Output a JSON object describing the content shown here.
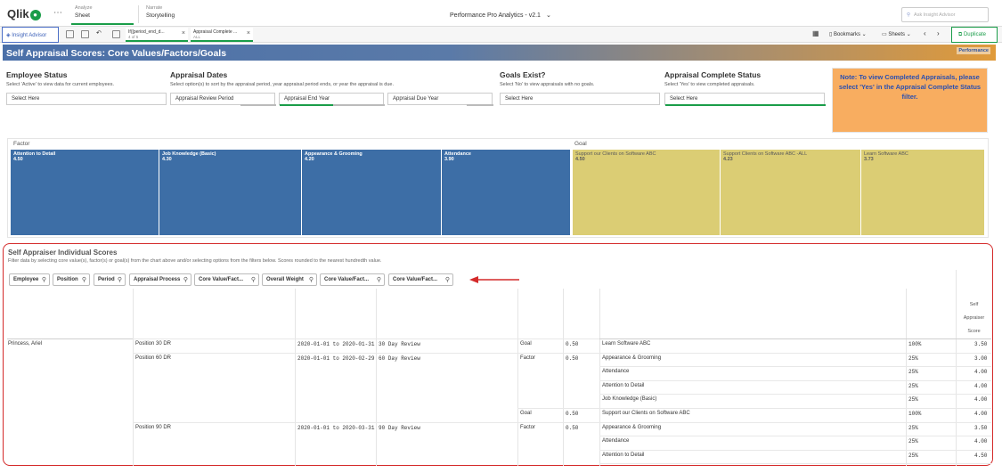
{
  "nav": {
    "logo": "Qlik",
    "analyze_small": "Analyze",
    "analyze_big": "Sheet",
    "narrate_small": "Narrate",
    "narrate_big": "Storytelling",
    "app_title": "Performance Pro Analytics - v2.1",
    "ask_placeholder": "Ask Insight Advisor"
  },
  "toolbar": {
    "insight_advisor": "Insight Advisor",
    "selections": [
      {
        "title": "If([period_end_d...",
        "sub": "4 of 5"
      },
      {
        "title": "Appraisal Complete ...",
        "sub": "ALL"
      }
    ],
    "bookmarks": "Bookmarks",
    "sheets": "Sheets",
    "duplicate": "Duplicate"
  },
  "sheet": {
    "title": "Self Appraisal Scores: Core Values/Factors/Goals",
    "logo_text": "Performance"
  },
  "filters": [
    {
      "heading": "Employee Status",
      "desc": "Select 'Active' to view data for current employees.",
      "value": "Select Here"
    },
    {
      "heading": "Appraisal Dates",
      "desc": "Select option(s) to sort by the appraisal period, year appraisal period ends, or year the appraisal is due.",
      "value": "Appraisal Review Period"
    },
    {
      "heading": "",
      "desc": "",
      "value": "Appraisal End Year"
    },
    {
      "heading": "",
      "desc": "",
      "value": "Appraisal Due Year"
    },
    {
      "heading": "Goals Exist?",
      "desc": "Select 'No' to view appraisals with no goals.",
      "value": "Select Here"
    },
    {
      "heading": "Appraisal Complete Status",
      "desc": "Select 'Yes' to view completed appraisals.",
      "value": "Select Here"
    }
  ],
  "note": "Note: To view Completed Appraisals, please select 'Yes' in the Appraisal Complete Status filter.",
  "treemap": {
    "factor_label": "Factor",
    "goal_label": "Goal",
    "factors": [
      {
        "name": "Attention to Detail",
        "value": "4.50"
      },
      {
        "name": "Job Knowledge (Basic)",
        "value": "4.30"
      },
      {
        "name": "Appearance & Grooming",
        "value": "4.20"
      },
      {
        "name": "Attendance",
        "value": "3.90"
      }
    ],
    "goals": [
      {
        "name": "Support our Clients on Software ABC",
        "value": "4.50"
      },
      {
        "name": "Support Clients on Software ABC -ALL",
        "value": "4.23"
      },
      {
        "name": "Learn Software ABC",
        "value": "3.73"
      }
    ]
  },
  "table": {
    "title": "Self Appraiser Individual Scores",
    "desc": "Filter data by selecting core value(s), factor(s) or goal(s) from the chart above and/or selecting options from the filters below. Scores rounded to the nearest hundredth value.",
    "column_searches": [
      "Employee",
      "Position",
      "Period",
      "Appraisal Process",
      "Core Value/Fact...",
      "Overall Weight",
      "Core Value/Fact...",
      "Core Value/Fact..."
    ],
    "score_header": [
      "Self",
      "Appraiser",
      "Score"
    ],
    "rows": [
      {
        "employee": "Princess, Ariel",
        "position": "Position 30 DR",
        "period": "2020-01-01 to 2020-01-31",
        "process": "30 Day Review",
        "type": "Goal",
        "weight": "0.50",
        "item": "Learn Software ABC",
        "pct": "100%",
        "score": "3.50"
      },
      {
        "employee": "",
        "position": "Position 60 DR",
        "period": "2020-01-01 to 2020-02-29",
        "process": "60 Day Review",
        "type": "Factor",
        "weight": "0.50",
        "item": "Appearance & Grooming",
        "pct": "25%",
        "score": "3.00"
      },
      {
        "employee": "",
        "position": "",
        "period": "",
        "process": "",
        "type": "",
        "weight": "",
        "item": "Attendance",
        "pct": "25%",
        "score": "4.00"
      },
      {
        "employee": "",
        "position": "",
        "period": "",
        "process": "",
        "type": "",
        "weight": "",
        "item": "Attention to Detail",
        "pct": "25%",
        "score": "4.00"
      },
      {
        "employee": "",
        "position": "",
        "period": "",
        "process": "",
        "type": "",
        "weight": "",
        "item": "Job Knowledge (Basic)",
        "pct": "25%",
        "score": "4.00"
      },
      {
        "employee": "",
        "position": "",
        "period": "",
        "process": "",
        "type": "Goal",
        "weight": "0.50",
        "item": "Support our Clients on Software ABC",
        "pct": "100%",
        "score": "4.00"
      },
      {
        "employee": "",
        "position": "Position 90 DR",
        "period": "2020-01-01 to 2020-03-31",
        "process": "90 Day Review",
        "type": "Factor",
        "weight": "0.50",
        "item": "Appearance & Grooming",
        "pct": "25%",
        "score": "3.50"
      },
      {
        "employee": "",
        "position": "",
        "period": "",
        "process": "",
        "type": "",
        "weight": "",
        "item": "Attendance",
        "pct": "25%",
        "score": "4.00"
      },
      {
        "employee": "",
        "position": "",
        "period": "",
        "process": "",
        "type": "",
        "weight": "",
        "item": "Attention to Detail",
        "pct": "25%",
        "score": "4.50"
      }
    ]
  },
  "colors": {
    "factor_tile": "#3d6ea6",
    "goal_tile": "#dbcd74",
    "accent_green": "#1a9d49",
    "highlight_red": "#d42a2a",
    "note_bg": "#f8ad60"
  }
}
